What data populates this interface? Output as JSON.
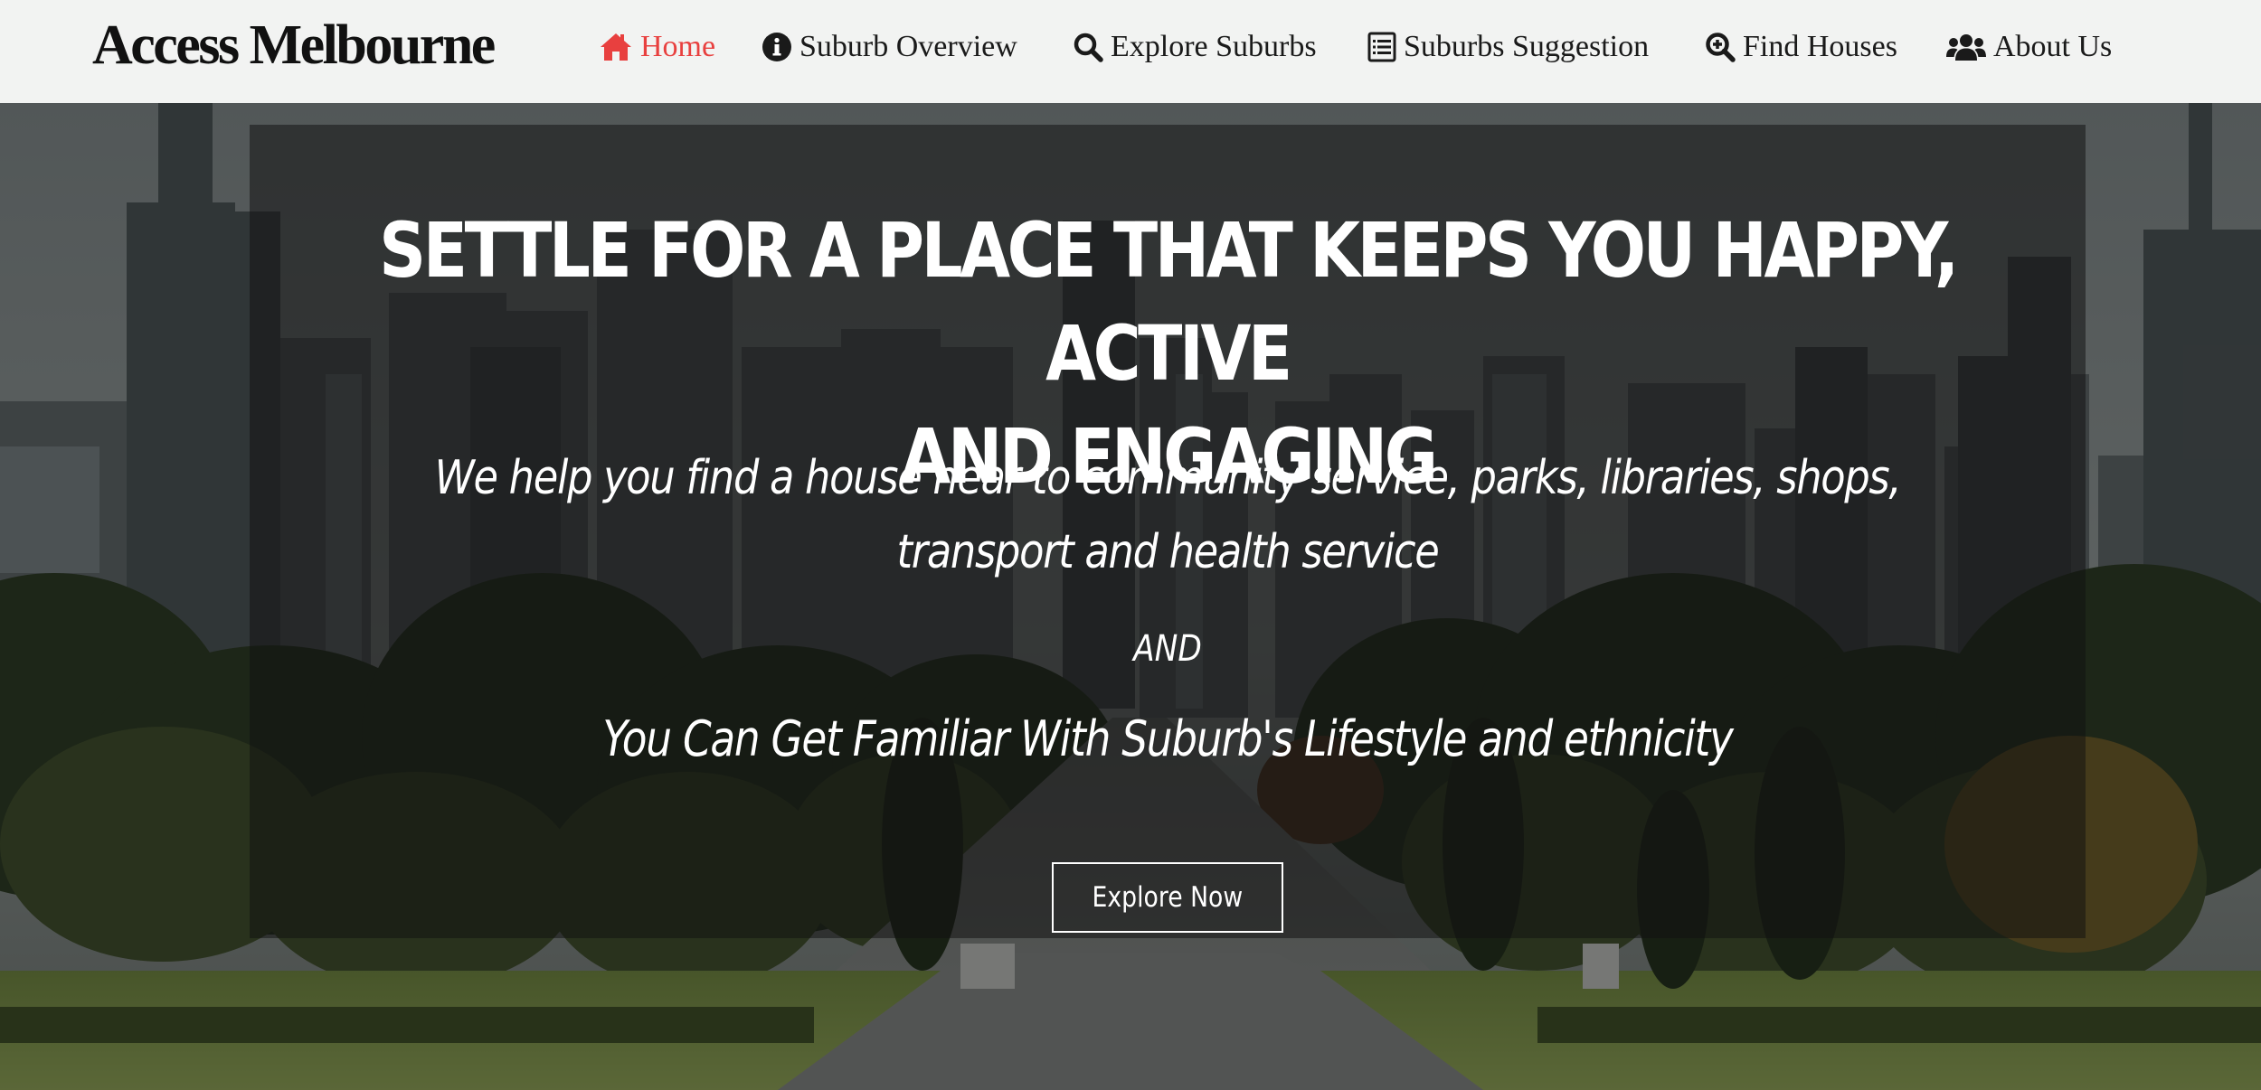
{
  "brand": {
    "name": "Access Melbourne"
  },
  "nav": {
    "items": [
      {
        "label": "Home",
        "icon": "home-icon",
        "active": true
      },
      {
        "label": "Suburb Overview",
        "icon": "info-circle-icon",
        "active": false
      },
      {
        "label": "Explore Suburbs",
        "icon": "search-icon",
        "active": false
      },
      {
        "label": "Suburbs Suggestion",
        "icon": "list-alt-icon",
        "active": false
      },
      {
        "label": "Find Houses",
        "icon": "search-plus-icon",
        "active": false
      },
      {
        "label": "About Us",
        "icon": "users-icon",
        "active": false
      }
    ]
  },
  "hero": {
    "headline_line1": "SETTLE FOR A PLACE THAT KEEPS YOU HAPPY, ACTIVE",
    "headline_line2": "AND ENGAGING",
    "subline_line1": "We help you find a house near to community service, parks, libraries, shops,",
    "subline_line2": "transport and health service",
    "and_word": "AND",
    "familiar": "You Can Get Familiar With Suburb's Lifestyle and ethnicity",
    "cta_label": "Explore Now"
  },
  "colors": {
    "accent": "#e8403f",
    "navbar_bg": "#f2f3f2",
    "text_dark": "#1a1a1a",
    "hero_text": "#ffffff"
  }
}
